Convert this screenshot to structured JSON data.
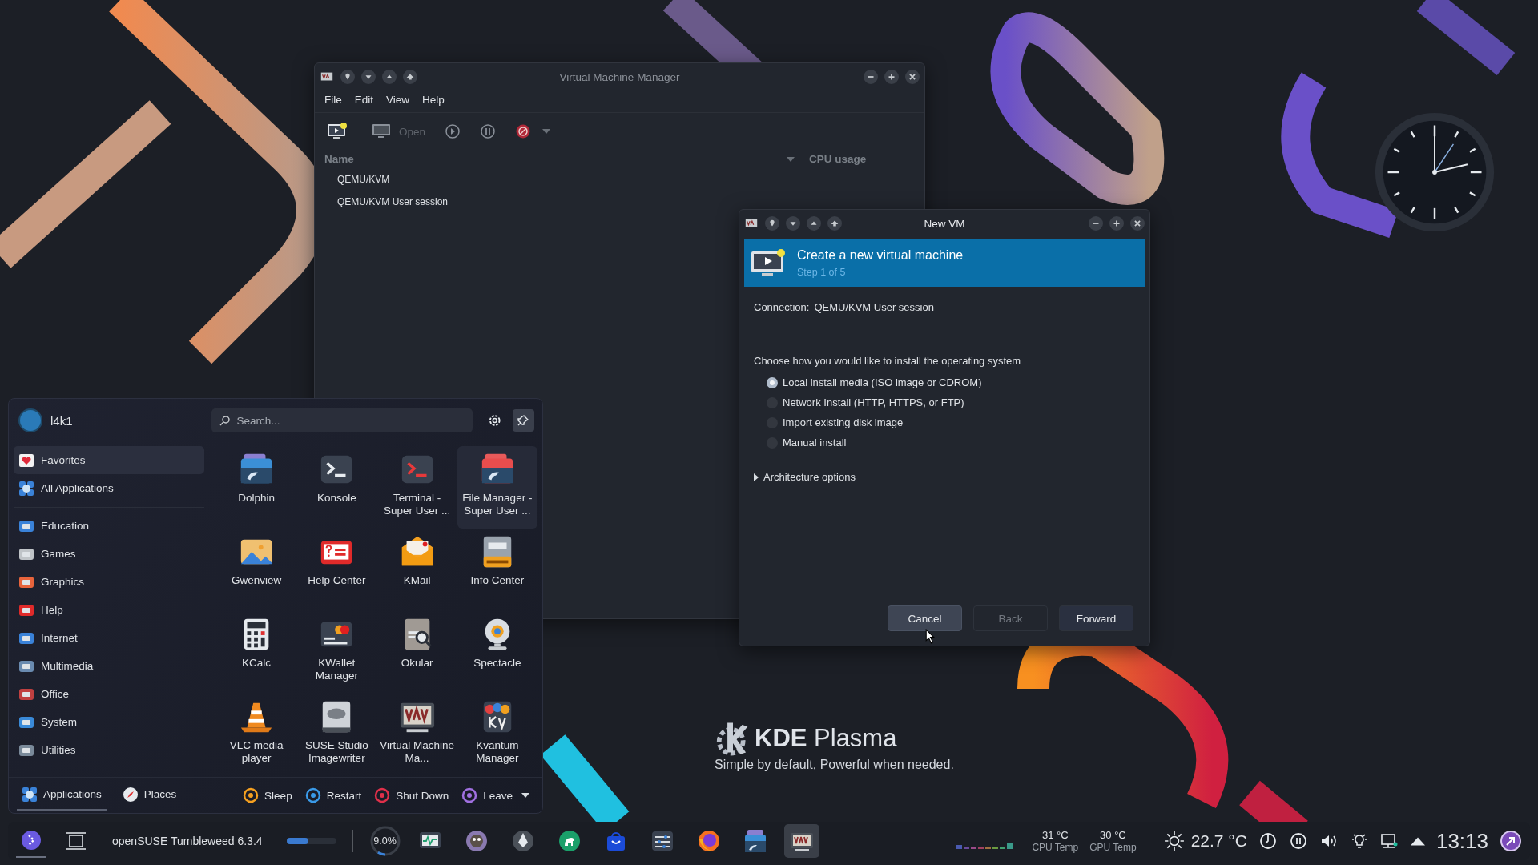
{
  "vm_manager": {
    "title": "Virtual Machine Manager",
    "menu": [
      "File",
      "Edit",
      "View",
      "Help"
    ],
    "toolbar": {
      "open_label": "Open",
      "open_disabled": true
    },
    "columns": [
      "Name",
      "CPU usage"
    ],
    "rows": [
      "QEMU/KVM",
      "QEMU/KVM User session"
    ]
  },
  "new_vm": {
    "title": "New VM",
    "header": {
      "title": "Create a new virtual machine",
      "step": "Step 1 of 5"
    },
    "connection": {
      "label": "Connection:",
      "value": "QEMU/KVM User session"
    },
    "prompt": "Choose how you would like to install the operating system",
    "options": [
      {
        "label": "Local install media (ISO image or CDROM)",
        "selected": true
      },
      {
        "label": "Network Install (HTTP, HTTPS, or FTP)",
        "selected": false
      },
      {
        "label": "Import existing disk image",
        "selected": false
      },
      {
        "label": "Manual install",
        "selected": false
      }
    ],
    "expander": {
      "label": "Architecture options",
      "expanded": false
    },
    "buttons": [
      {
        "label": "Cancel",
        "disabled": false,
        "hovered": true
      },
      {
        "label": "Back",
        "disabled": true,
        "hovered": false
      },
      {
        "label": "Forward",
        "disabled": false,
        "hovered": false
      }
    ]
  },
  "launcher": {
    "user": "l4k1",
    "search": {
      "placeholder": "Search..."
    },
    "pinned": [
      {
        "label": "Favorites",
        "selected": true
      },
      {
        "label": "All Applications",
        "selected": false
      }
    ],
    "categories": [
      {
        "label": "Education",
        "selected": false
      },
      {
        "label": "Games",
        "selected": false
      },
      {
        "label": "Graphics",
        "selected": false
      },
      {
        "label": "Help",
        "selected": false
      },
      {
        "label": "Internet",
        "selected": false
      },
      {
        "label": "Multimedia",
        "selected": false
      },
      {
        "label": "Office",
        "selected": false
      },
      {
        "label": "System",
        "selected": false
      },
      {
        "label": "Utilities",
        "selected": false
      }
    ],
    "apps": [
      {
        "label": "Dolphin",
        "highlighted": false
      },
      {
        "label": "Konsole",
        "highlighted": false
      },
      {
        "label": "Terminal - Super User ...",
        "highlighted": false
      },
      {
        "label": "File Manager - Super User ...",
        "highlighted": true
      },
      {
        "label": "Gwenview",
        "highlighted": false
      },
      {
        "label": "Help Center",
        "highlighted": false
      },
      {
        "label": "KMail",
        "highlighted": false
      },
      {
        "label": "Info Center",
        "highlighted": false
      },
      {
        "label": "KCalc",
        "highlighted": false
      },
      {
        "label": "KWallet Manager",
        "highlighted": false
      },
      {
        "label": "Okular",
        "highlighted": false
      },
      {
        "label": "Spectacle",
        "highlighted": false
      },
      {
        "label": "VLC media player",
        "highlighted": false
      },
      {
        "label": "SUSE Studio Imagewriter",
        "highlighted": false
      },
      {
        "label": "Virtual Machine Ma...",
        "highlighted": false
      },
      {
        "label": "Kvantum Manager",
        "highlighted": false
      }
    ],
    "tabs": [
      {
        "label": "Applications",
        "selected": true
      },
      {
        "label": "Places",
        "selected": false
      }
    ],
    "power": [
      "Sleep",
      "Restart",
      "Shut Down",
      "Leave"
    ]
  },
  "desktop": {
    "brand": "**KDE** Plasma",
    "tagline": "Simple by default, Powerful when needed."
  },
  "taskbar": {
    "window_title": "openSUSE Tumbleweed 6.3.4",
    "progress": {
      "level": 0.45
    },
    "cpu": {
      "reading": "9.0%",
      "level": 0.09
    },
    "tasks": [
      {
        "active": false
      },
      {
        "active": false
      },
      {
        "active": false
      },
      {
        "active": false
      },
      {
        "active": false
      },
      {
        "active": false
      },
      {
        "active": false
      },
      {
        "active": false
      },
      {
        "active": true
      }
    ],
    "sensors": [
      {
        "value": "31 °C",
        "label": "CPU Temp"
      },
      {
        "value": "30 °C",
        "label": "GPU Temp"
      }
    ],
    "weather": "22.7 °C",
    "clock": "13:13"
  }
}
